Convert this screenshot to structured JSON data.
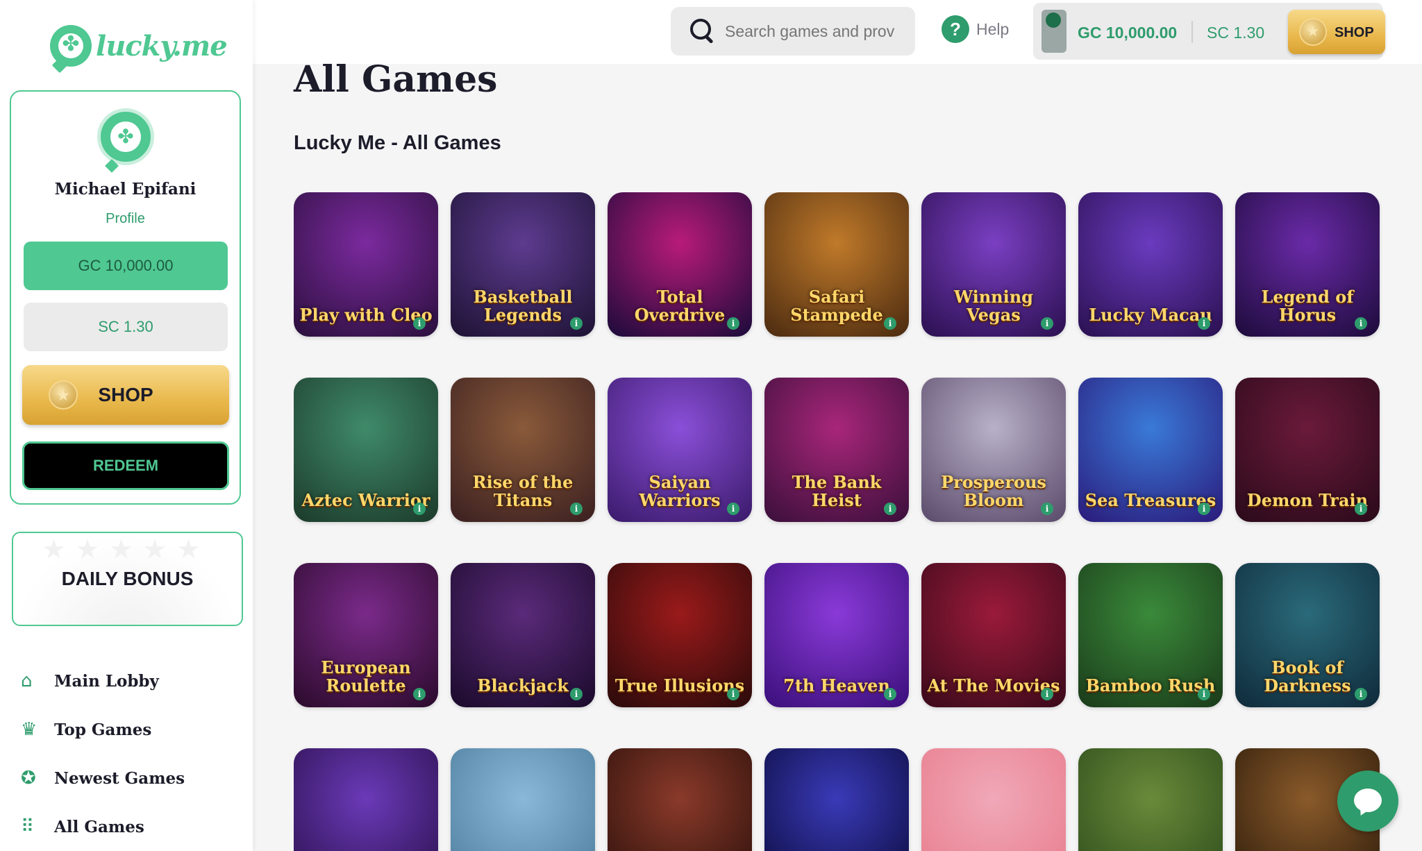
{
  "brand": {
    "name": "lucky.me",
    "accent": "#4fc892",
    "accent_dark": "#2e9c6c",
    "gold": "#e9b84c"
  },
  "sidebar": {
    "user_name": "Michael Epifani",
    "profile_label": "Profile",
    "gc_balance": "GC 10,000.00",
    "sc_balance": "SC 1.30",
    "shop_label": "SHOP",
    "redeem_label": "REDEEM",
    "daily_bonus_label": "DAILY BONUS",
    "nav": [
      {
        "label": "Main Lobby",
        "icon": "home-icon"
      },
      {
        "label": "Top Games",
        "icon": "crown-icon"
      },
      {
        "label": "Newest Games",
        "icon": "star-badge-icon"
      },
      {
        "label": "All Games",
        "icon": "grid-dots-icon"
      }
    ]
  },
  "topbar": {
    "search_placeholder": "Search games and prov",
    "help_label": "Help",
    "gc_balance": "GC 10,000.00",
    "sc_balance": "SC 1.30",
    "shop_label": "SHOP"
  },
  "main": {
    "title": "All Games",
    "section_title": "Lucky Me - All Games",
    "games": [
      {
        "name": "Play with Cleo",
        "bg": [
          "#7b2a9e",
          "#2a0f3c"
        ]
      },
      {
        "name": "Basketball Legends",
        "bg": [
          "#5d3b8f",
          "#1d1233"
        ]
      },
      {
        "name": "Total Overdrive",
        "bg": [
          "#b81b7a",
          "#1a0a3a"
        ]
      },
      {
        "name": "Safari Stampede",
        "bg": [
          "#c07a2a",
          "#4a2a10"
        ]
      },
      {
        "name": "Winning Vegas",
        "bg": [
          "#7a3fc2",
          "#2a0f4f"
        ]
      },
      {
        "name": "Lucky Macau",
        "bg": [
          "#6a3bbf",
          "#2a1050"
        ]
      },
      {
        "name": "Legend of Horus",
        "bg": [
          "#6a2aa8",
          "#1c0b3a"
        ]
      },
      {
        "name": "Aztec Warrior",
        "bg": [
          "#3f8a6a",
          "#1c3a2a"
        ]
      },
      {
        "name": "Rise of the Titans",
        "bg": [
          "#8a5a3a",
          "#3a1f20"
        ]
      },
      {
        "name": "Saiyan Warriors",
        "bg": [
          "#8a4fd8",
          "#3a1a6a"
        ]
      },
      {
        "name": "The Bank Heist",
        "bg": [
          "#a8267a",
          "#3a0f3a"
        ]
      },
      {
        "name": "Prosperous Bloom",
        "bg": [
          "#b8b0c8",
          "#5a4a6a"
        ]
      },
      {
        "name": "Sea Treasures",
        "bg": [
          "#3a7ad8",
          "#2a1a7a"
        ]
      },
      {
        "name": "Demon Train",
        "bg": [
          "#6a1a3a",
          "#2a0a1a"
        ]
      },
      {
        "name": "European Roulette",
        "bg": [
          "#7a2a8a",
          "#2a0a2a"
        ]
      },
      {
        "name": "Blackjack",
        "bg": [
          "#5a2a7a",
          "#1a0a2a"
        ]
      },
      {
        "name": "True Illusions",
        "bg": [
          "#9a1a1a",
          "#2a0a0a"
        ]
      },
      {
        "name": "7th Heaven",
        "bg": [
          "#8a3ad8",
          "#3a0f7a"
        ]
      },
      {
        "name": "At The Movies",
        "bg": [
          "#9a1a3a",
          "#3a0a1a"
        ]
      },
      {
        "name": "Bamboo Rush",
        "bg": [
          "#3a8a3a",
          "#1a3a1a"
        ]
      },
      {
        "name": "Book of Darkness",
        "bg": [
          "#2a6a7a",
          "#0f2a3a"
        ]
      },
      {
        "name": "",
        "bg": [
          "#6a3ab8",
          "#2a0f4a"
        ]
      },
      {
        "name": "",
        "bg": [
          "#8ab8d8",
          "#4a7a9a"
        ]
      },
      {
        "name": "",
        "bg": [
          "#8a3a2a",
          "#2a0f0a"
        ]
      },
      {
        "name": "",
        "bg": [
          "#3a3ab8",
          "#0a0a3a"
        ]
      },
      {
        "name": "",
        "bg": [
          "#f0a8b8",
          "#e87a8a"
        ]
      },
      {
        "name": "",
        "bg": [
          "#6a8a3a",
          "#2a4a1a"
        ]
      },
      {
        "name": "",
        "bg": [
          "#8a5a2a",
          "#2a1a0a"
        ]
      }
    ]
  }
}
